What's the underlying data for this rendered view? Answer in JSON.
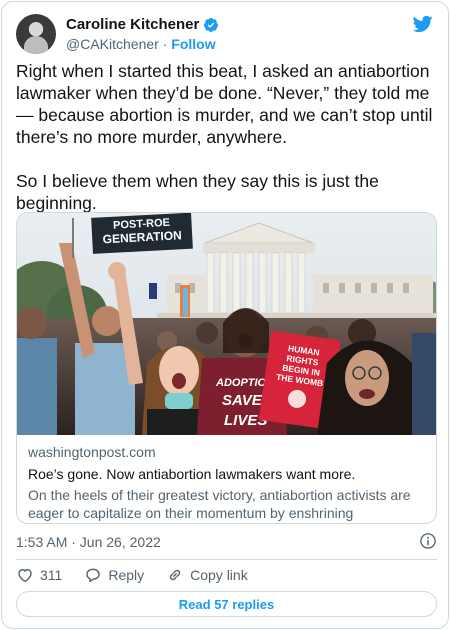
{
  "author": {
    "display_name": "Caroline Kitchener",
    "handle": "@CAKitchener",
    "separator": "·",
    "follow_label": "Follow"
  },
  "tweet": {
    "text": "Right when I started this beat, I asked an antiabortion lawmaker when they’d be done. “Never,” they told me — because abortion is murder, and we can’t stop until there’s no more murder, anywhere.\n\nSo I believe them when they say this is just the beginning."
  },
  "link_card": {
    "domain": "washingtonpost.com",
    "title": "Roe’s gone. Now antiabortion lawmakers want more.",
    "description": "On the heels of their greatest victory, antiabortion activists are eager to capitalize on their momentum by enshrining constitutional …",
    "photo_signs": {
      "sign1": "POST-ROE",
      "sign1_line2": "GENERATION",
      "sign2_line1": "HUMAN",
      "sign2_line2": "RIGHTS",
      "sign2_line3": "BEGIN IN",
      "sign2_line4": "THE WOMB",
      "shirt_line1": "ADOPTION",
      "shirt_line2": "SAVES",
      "shirt_line3": "LIVES"
    }
  },
  "timestamp": "1:53 AM · Jun 26, 2022",
  "actions": {
    "like_count": "311",
    "reply_label": "Reply",
    "copy_link_label": "Copy link"
  },
  "replies_button_label": "Read 57 replies",
  "colors": {
    "accent": "#1d9bf0",
    "text": "#0f1419",
    "secondary": "#536471",
    "border": "#cfd9de",
    "sign_red": "#d6243a"
  }
}
